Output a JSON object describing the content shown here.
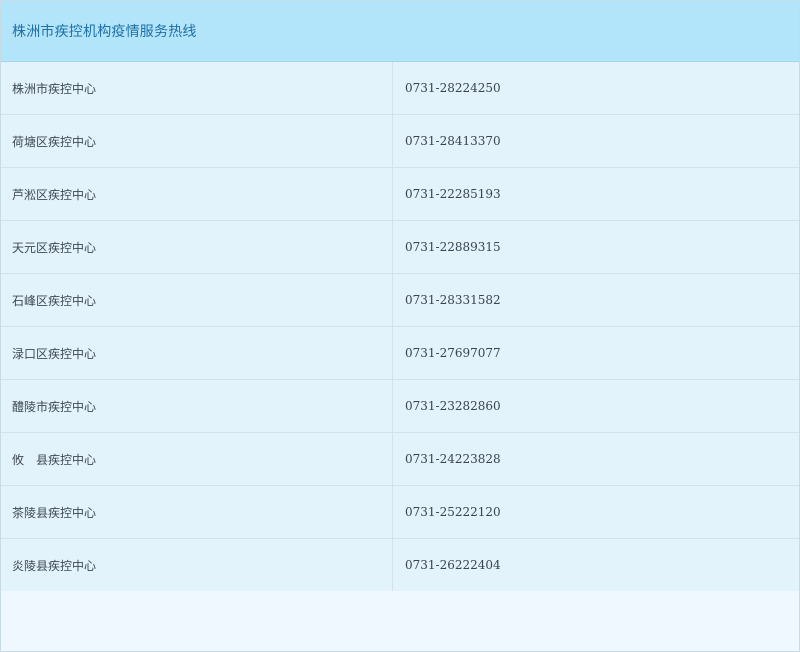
{
  "header": {
    "title": "株洲市疾控机构疫情服务热线"
  },
  "table": {
    "rows": [
      {
        "name": "株洲市疾控中心",
        "phone": "0731-28224250"
      },
      {
        "name": "荷塘区疾控中心",
        "phone": "0731-28413370"
      },
      {
        "name": "芦淞区疾控中心",
        "phone": "0731-22285193"
      },
      {
        "name": "天元区疾控中心",
        "phone": "0731-22889315"
      },
      {
        "name": "石峰区疾控中心",
        "phone": "0731-28331582"
      },
      {
        "name": "渌口区疾控中心",
        "phone": "0731-27697077"
      },
      {
        "name": "醴陵市疾控中心",
        "phone": "0731-23282860"
      },
      {
        "name": "攸　县疾控中心",
        "phone": "0731-24223828"
      },
      {
        "name": "茶陵县疾控中心",
        "phone": "0731-25222120"
      },
      {
        "name": "炎陵县疾控中心",
        "phone": "0731-26222404"
      }
    ]
  },
  "colors": {
    "header_bg": "#b2e4fa",
    "header_text": "#1f6fa8",
    "row_bg": "#e2f3fc",
    "footer_bg": "#eef8fe"
  }
}
